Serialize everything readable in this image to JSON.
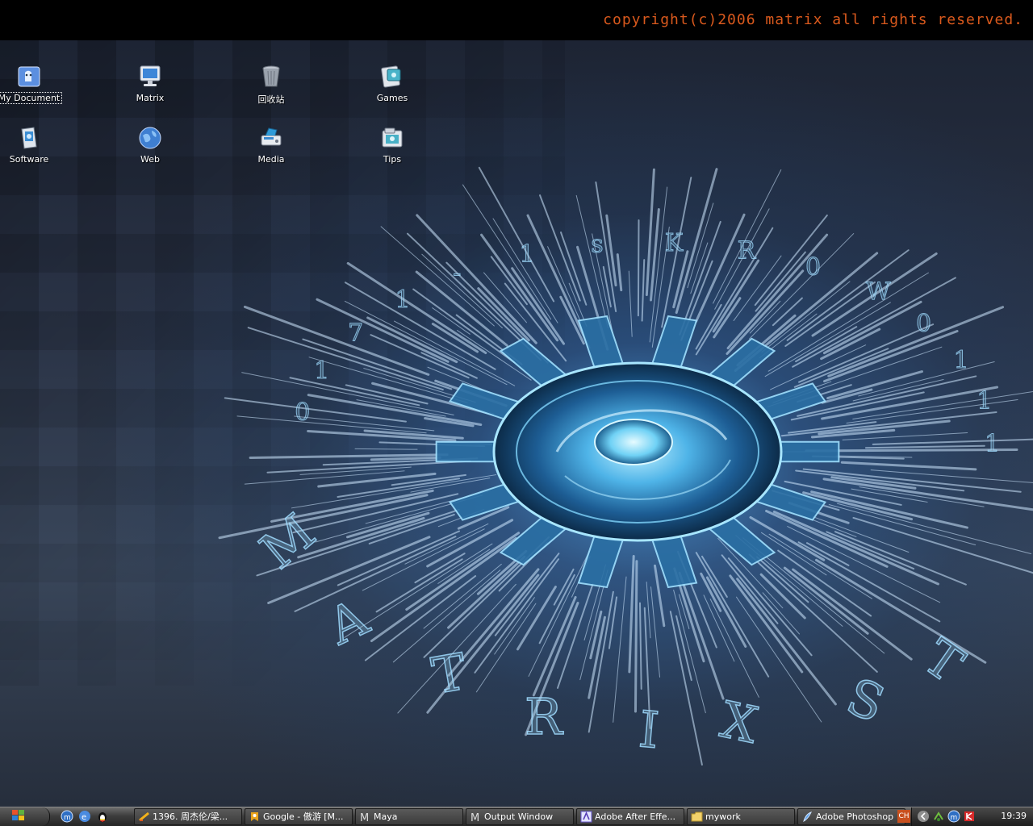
{
  "banner": {
    "copyright_text": "copyright(c)2006 matrix all rights reserved."
  },
  "wallpaper": {
    "ring_text": "MATRIX S"
  },
  "desktop_icons": [
    {
      "label": "My Document",
      "icon": "my-document-icon",
      "selected": true
    },
    {
      "label": "Matrix",
      "icon": "computer-monitor-icon"
    },
    {
      "label": "回收站",
      "icon": "recycle-bin-icon"
    },
    {
      "label": "Games",
      "icon": "games-icon"
    },
    {
      "label": "Software",
      "icon": "software-icon"
    },
    {
      "label": "Web",
      "icon": "globe-icon"
    },
    {
      "label": "Media",
      "icon": "media-icon"
    },
    {
      "label": "Tips",
      "icon": "tips-icon"
    }
  ],
  "taskbar": {
    "tasks": [
      {
        "label": "1396. 周杰伦/梁...",
        "icon": "winamp-icon"
      },
      {
        "label": "Google - 傲游 [M...",
        "icon": "maxthon-browser-icon"
      },
      {
        "label": "Maya",
        "icon": "maya-icon"
      },
      {
        "label": "Output Window",
        "icon": "maya-output-icon"
      },
      {
        "label": "Adobe After Effe...",
        "icon": "after-effects-icon"
      },
      {
        "label": "mywork",
        "icon": "folder-icon"
      },
      {
        "label": "Adobe Photoshop",
        "icon": "photoshop-icon"
      }
    ],
    "language": "CH",
    "clock": "19:39"
  },
  "colors": {
    "copyright": "#d9591d",
    "banner_bg": "#000000",
    "taskbar": "#3d3d3d"
  }
}
